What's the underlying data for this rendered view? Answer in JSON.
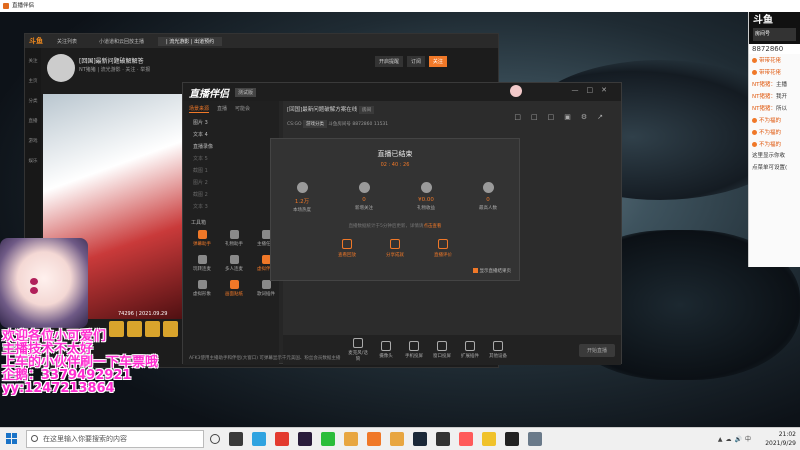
{
  "window": {
    "title": "直播伴侣"
  },
  "chat_panel": {
    "logo": "斗鱼",
    "badge": "房间号",
    "room_number": "8872860",
    "messages": [
      {
        "user": "",
        "text": "带带花佬"
      },
      {
        "user": "",
        "text": "带带花佬"
      },
      {
        "user": "NT猪猪：",
        "text": "主播"
      },
      {
        "user": "NT猪猪：",
        "text": "我开"
      },
      {
        "user": "NT猪猪：",
        "text": "所以"
      },
      {
        "user": "",
        "text": "不为福的"
      },
      {
        "user": "",
        "text": "不为福的"
      },
      {
        "user": "",
        "text": "不为福的"
      }
    ],
    "note_lines": [
      "这里显示你收",
      "点菜单可设置("
    ]
  },
  "douyu": {
    "logo": "斗鱼",
    "tabs": [
      "关注列表",
      "小道道和云回放主播",
      "| 流光游影 | 出道预约",
      ""
    ],
    "room_title": "[回国]最新问题破解解答",
    "room_sub": "NT猪猪  | 流光游影  ·  关注 · 举报",
    "buttons": [
      "开启提醒",
      "订阅",
      "关注"
    ],
    "side_items": [
      "关注",
      "主页",
      "分类",
      "直播",
      "游戏",
      "娱乐"
    ],
    "video_date": "74296 | 2021.09.29"
  },
  "companion": {
    "logo": "直播伴侣",
    "version": "测试版",
    "scene_tabs": [
      "场景来源",
      "直播",
      "可能会"
    ],
    "sources": [
      {
        "name": "图片 3",
        "dim": false
      },
      {
        "name": "文本 4",
        "dim": false
      },
      {
        "name": "直播录像",
        "dim": false
      },
      {
        "name": "文本 5",
        "dim": true
      },
      {
        "name": "截图 1",
        "dim": true
      },
      {
        "name": "图片 2",
        "dim": true
      },
      {
        "name": "截图 2",
        "dim": true
      },
      {
        "name": "文本 3",
        "dim": true
      }
    ],
    "tools_heading": "工具箱",
    "tools": [
      {
        "label": "弹幕助手",
        "hot": true
      },
      {
        "label": "礼物助手",
        "hot": false
      },
      {
        "label": "主播任务",
        "hot": false
      },
      {
        "label": "玩转连麦",
        "hot": false
      },
      {
        "label": "多人连麦",
        "hot": false
      },
      {
        "label": "虚拟伴侣",
        "hot": true
      },
      {
        "label": "虚拟形象",
        "hot": false
      },
      {
        "label": "画面贴纸",
        "hot": true
      },
      {
        "label": "歌词插件",
        "hot": false
      }
    ],
    "room_name": "[回国]最新问题破解方案在线",
    "room_label": "房间",
    "meta_game": "CS:GO",
    "meta_cat": "游戏分类",
    "meta_room_label": "斗鱼房间号",
    "meta_room_no": "8872860",
    "meta_count": "11531",
    "bottom_buttons": [
      "麦克风/话筒",
      "摄像头",
      "手机投屏",
      "窗口投屏",
      "扩展插件",
      "其他设备"
    ],
    "start_button": "开始直播",
    "status": "AFK3使用主播助手和伴侣(大窗口)    可弹幕显示千元美国、粉丝会员数据主播"
  },
  "dialog": {
    "title": "直播已结束",
    "duration": "02 : 40 : 26",
    "stats": [
      {
        "value": "1.2万",
        "label": "本场热度"
      },
      {
        "value": "0",
        "label": "新增关注"
      },
      {
        "value": "¥0.00",
        "label": "礼物收益"
      },
      {
        "value": "0",
        "label": "最高人数"
      }
    ],
    "hint_prefix": "直播数据统计于5分钟后更新，详情请",
    "hint_link": "点击查看",
    "actions": [
      "查看回放",
      "分享成就",
      "直播评价"
    ],
    "checkbox": "显示直播结果页"
  },
  "overlay": {
    "lines": [
      "欢迎各位小可爱们",
      "主播技术不太好",
      "上车的小伙伴刷一下车票哦",
      "企鹅：3379492921",
      "yy:1247213864"
    ]
  },
  "taskbar": {
    "search_placeholder": "在这里输入你要搜索的内容",
    "time": "21:02",
    "date": "2021/9/29"
  },
  "colors": {
    "accent": "#f07828",
    "overlay_text": "#ff2ed1"
  }
}
